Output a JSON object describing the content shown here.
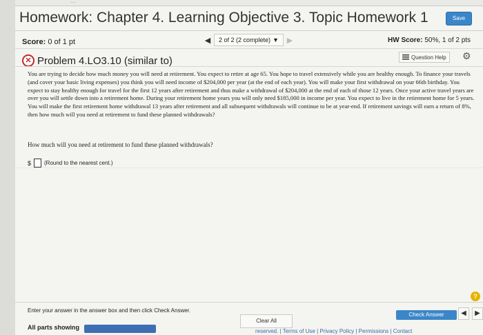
{
  "header": {
    "title": "Homework: Chapter 4. Learning Objective 3. Topic Homework 1",
    "save_label": "Save",
    "top_strip_text": "..."
  },
  "score": {
    "label": "Score:",
    "value": "0 of 1 pt"
  },
  "navigation": {
    "prev_icon": "◀",
    "progress_text": "2 of 2 (2 complete)",
    "dropdown_icon": "▼",
    "next_icon": "▶"
  },
  "hw_score": {
    "label": "HW Score:",
    "value": "50%, 1 of 2 pts"
  },
  "problem": {
    "status_icon": "x-circle",
    "title": "Problem 4.LO3.10 (similar to)",
    "question_help_label": "Question Help",
    "settings_icon": "gear"
  },
  "body": {
    "paragraph": "You are trying to decide how much money you will need at retirement. You expect to retire at age 65. You hope to travel extensively while you are healthy enough. To finance your travels (and cover your basic living expenses) you think you will need income of $204,000 per year (at the end of each year). You will make your first withdrawal on your 66th birthday. You expect to stay healthy enough for travel for the first 12 years after retirement and thus make a withdrawal of $204,000 at the end of each of those 12 years. Once your active travel years are over you will settle down into a retirement home. During your retirement home years you will only need $185,000 in income per year. You expect to live in the retirement home for 5 years. You will make the first retirement home withdrawal 13 years after retirement and all subsequent withdrawals will continue to be at year-end. If retirement savings will earn a return of 8%, then how much will you need at retirement to fund these planned withdrawals?",
    "question": "How much will you need at retirement to fund these planned withdrawals?",
    "answer_prefix": "$",
    "answer_hint": "(Round to the nearest cent.)"
  },
  "footer": {
    "instruction": "Enter your answer in the answer box and then click Check Answer.",
    "parts_label": "All parts showing",
    "clear_label": "Clear All",
    "check_label": "Check Answer",
    "help_icon": "?",
    "links": "reserved. | Terms of Use | Privacy Policy | Permissions | Contact"
  },
  "colors": {
    "accent": "#3a86c8",
    "error": "#c02a2a",
    "help": "#e6b400",
    "progress": "#3e6fb3"
  }
}
